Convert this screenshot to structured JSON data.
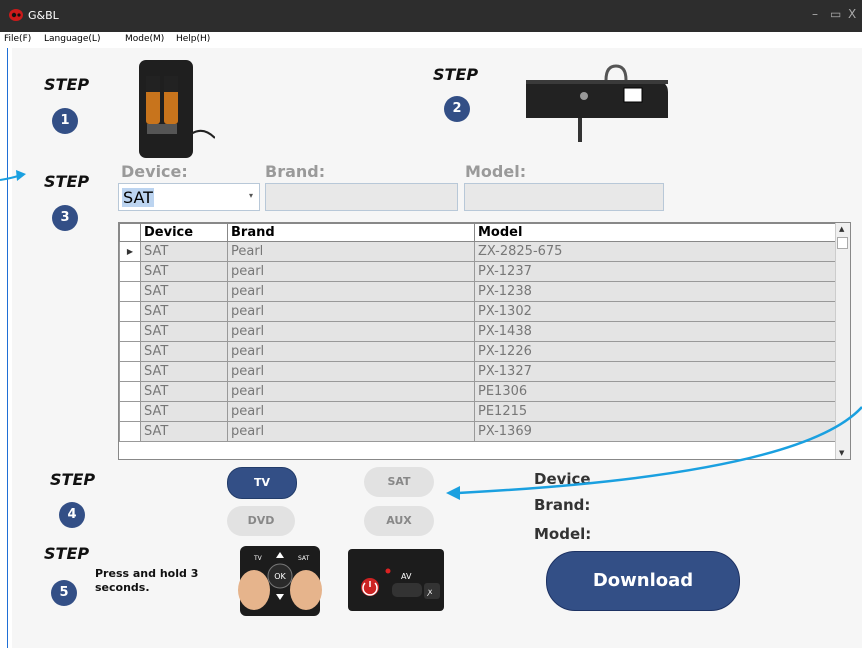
{
  "window": {
    "title": "G&BL",
    "minimize": "–",
    "maximize": "▭",
    "close": "X"
  },
  "menu": [
    "File(F)",
    "Language(L)",
    "Mode(M)",
    "Help(H)"
  ],
  "steps": {
    "label": "STEP",
    "numbers": [
      "1",
      "2",
      "3",
      "4",
      "5"
    ]
  },
  "step3": {
    "device_label": "Device:",
    "brand_label": "Brand:",
    "model_label": "Model:",
    "device_value": "SAT",
    "brand_value": "",
    "model_value": ""
  },
  "grid": {
    "columns": [
      "Device",
      "Brand",
      "Model"
    ],
    "rows": [
      [
        "SAT",
        "Pearl",
        "ZX-2825-675"
      ],
      [
        "SAT",
        "pearl",
        "PX-1237"
      ],
      [
        "SAT",
        "pearl",
        "PX-1238"
      ],
      [
        "SAT",
        "pearl",
        "PX-1302"
      ],
      [
        "SAT",
        "pearl",
        "PX-1438"
      ],
      [
        "SAT",
        "pearl",
        "PX-1226"
      ],
      [
        "SAT",
        "pearl",
        "PX-1327"
      ],
      [
        "SAT",
        "pearl",
        "PE1306"
      ],
      [
        "SAT",
        "pearl",
        "PE1215"
      ],
      [
        "SAT",
        "pearl",
        "PX-1369"
      ]
    ],
    "selected_row": 0
  },
  "step4": {
    "buttons": [
      "TV",
      "SAT",
      "DVD",
      "AUX"
    ],
    "active": "TV",
    "info": {
      "device": "Device",
      "brand": "Brand:",
      "model": "Model:"
    }
  },
  "step5": {
    "note_line1": "Press and hold 3",
    "note_line2": "seconds."
  },
  "download_label": "Download",
  "remote_keys": {
    "tv": "TV",
    "sat": "SAT",
    "ok": "OK",
    "av": "AV"
  },
  "colors": {
    "accent": "#334f86",
    "arrow": "#1aa0e0",
    "titlebar": "#2d2d2d"
  }
}
